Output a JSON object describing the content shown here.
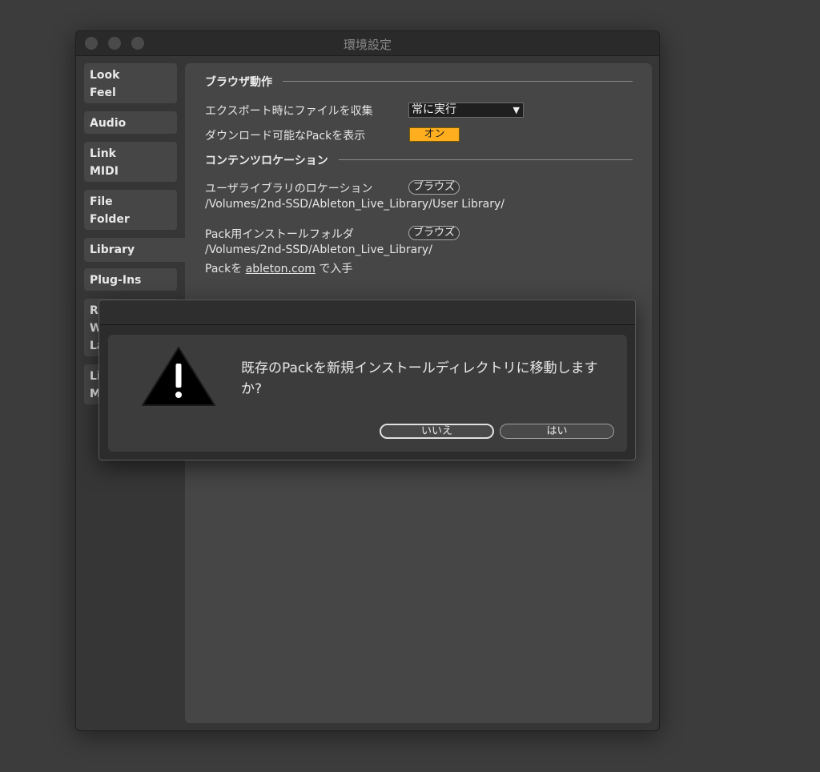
{
  "window": {
    "title": "環境設定"
  },
  "sidebar": {
    "items": [
      {
        "line1": "Look",
        "line2": "Feel"
      },
      {
        "line1": "Audio"
      },
      {
        "line1": "Link",
        "line2": "MIDI"
      },
      {
        "line1": "File",
        "line2": "Folder"
      },
      {
        "line1": "Library"
      },
      {
        "line1": "Plug-Ins"
      },
      {
        "line1": "Re",
        "line2": "W",
        "line3": "La"
      },
      {
        "line1": "Li",
        "line2": "M"
      }
    ]
  },
  "content": {
    "browser_section": "ブラウザ動作",
    "collect_label": "エクスポート時にファイルを収集",
    "collect_value": "常に実行",
    "show_packs_label": "ダウンロード可能なPackを表示",
    "show_packs_value": "オン",
    "content_section": "コンテンツロケーション",
    "user_library_label": "ユーザライブラリのロケーション",
    "browse_label": "ブラウズ",
    "user_library_path": "/Volumes/2nd-SSD/Ableton_Live_Library/User Library/",
    "pack_folder_label": "Pack用インストールフォルダ",
    "pack_folder_path": "/Volumes/2nd-SSD/Ableton_Live_Library/",
    "get_packs_prefix": "Packを",
    "get_packs_link": "ableton.com",
    "get_packs_suffix": "で入手"
  },
  "dialog": {
    "message": "既存のPackを新規インストールディレクトリに移動しますか?",
    "no_label": "いいえ",
    "yes_label": "はい"
  },
  "colors": {
    "accent": "#ffae1f",
    "background": "#3c3c3c"
  }
}
